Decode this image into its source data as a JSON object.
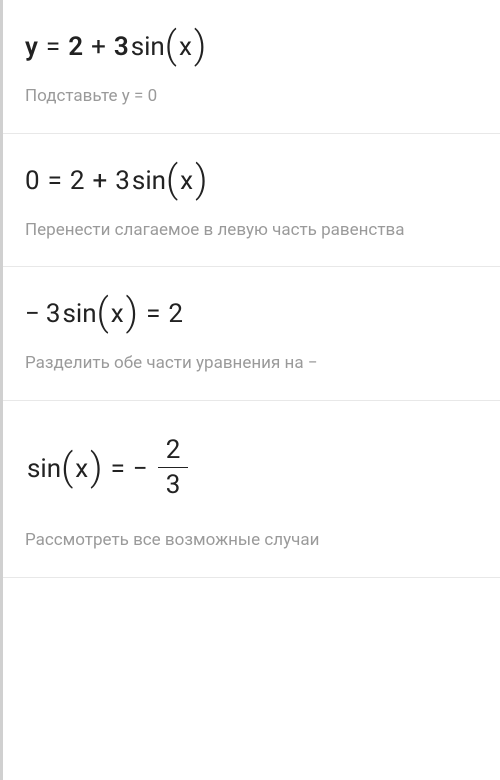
{
  "steps": [
    {
      "equation": {
        "lhs_var": "y",
        "eq": "=",
        "rhs_a": "2",
        "op": "+",
        "coef": "3",
        "func": "sin",
        "arg": "x"
      },
      "hint": "Подставьте y = 0"
    },
    {
      "equation": {
        "lhs_val": "0",
        "eq": "=",
        "rhs_a": "2",
        "op": "+",
        "coef": "3",
        "func": "sin",
        "arg": "x"
      },
      "hint": "Перенести слагаемое в левую часть равенства"
    },
    {
      "equation": {
        "neg": "−",
        "coef": "3",
        "func": "sin",
        "arg": "x",
        "eq": "=",
        "rhs": "2"
      },
      "hint": "Разделить обе части уравнения на −"
    },
    {
      "equation": {
        "func": "sin",
        "arg": "x",
        "eq": "=",
        "neg": "−",
        "num": "2",
        "den": "3"
      },
      "hint": "Рассмотреть все возможные случаи"
    }
  ]
}
